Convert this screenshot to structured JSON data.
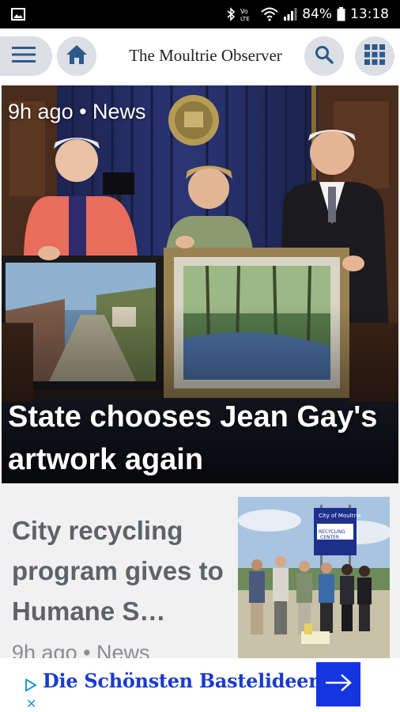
{
  "status_bar": {
    "battery": "84%",
    "time": "13:18",
    "icons": [
      "gallery-notification-icon",
      "bluetooth-icon",
      "volte-icon",
      "wifi-icon",
      "signal-icon",
      "battery-icon"
    ]
  },
  "app_bar": {
    "title": "The Moultrie Observer",
    "icons": [
      "menu-icon",
      "home-icon",
      "search-icon",
      "apps-grid-icon"
    ]
  },
  "hero": {
    "meta": "9h ago • News",
    "title": "State chooses Jean Gay's artwork again"
  },
  "story": {
    "title": "City recycling program gives to Humane S…",
    "meta": "9h ago • News",
    "thumb_sign": "City of Moultrie RECYCLING CENTER"
  },
  "ad": {
    "text": "Die Schönsten Bastelideen",
    "close": "✕",
    "accent": "#1535e0"
  }
}
